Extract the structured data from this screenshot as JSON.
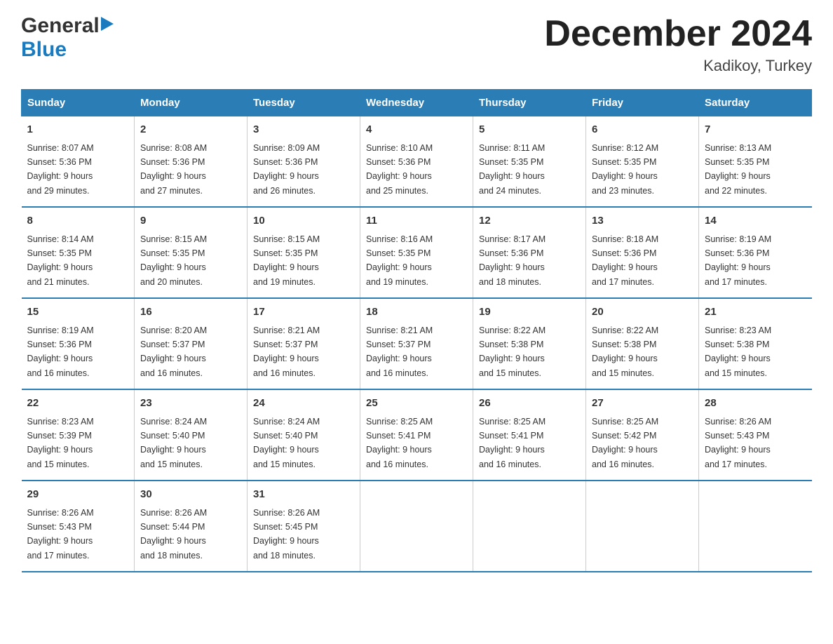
{
  "logo": {
    "general": "General",
    "blue": "Blue",
    "arrow_char": "▶"
  },
  "title": {
    "month_year": "December 2024",
    "location": "Kadikoy, Turkey"
  },
  "days_header": [
    "Sunday",
    "Monday",
    "Tuesday",
    "Wednesday",
    "Thursday",
    "Friday",
    "Saturday"
  ],
  "weeks": [
    [
      {
        "day": "1",
        "sunrise": "8:07 AM",
        "sunset": "5:36 PM",
        "daylight": "9 hours and 29 minutes."
      },
      {
        "day": "2",
        "sunrise": "8:08 AM",
        "sunset": "5:36 PM",
        "daylight": "9 hours and 27 minutes."
      },
      {
        "day": "3",
        "sunrise": "8:09 AM",
        "sunset": "5:36 PM",
        "daylight": "9 hours and 26 minutes."
      },
      {
        "day": "4",
        "sunrise": "8:10 AM",
        "sunset": "5:36 PM",
        "daylight": "9 hours and 25 minutes."
      },
      {
        "day": "5",
        "sunrise": "8:11 AM",
        "sunset": "5:35 PM",
        "daylight": "9 hours and 24 minutes."
      },
      {
        "day": "6",
        "sunrise": "8:12 AM",
        "sunset": "5:35 PM",
        "daylight": "9 hours and 23 minutes."
      },
      {
        "day": "7",
        "sunrise": "8:13 AM",
        "sunset": "5:35 PM",
        "daylight": "9 hours and 22 minutes."
      }
    ],
    [
      {
        "day": "8",
        "sunrise": "8:14 AM",
        "sunset": "5:35 PM",
        "daylight": "9 hours and 21 minutes."
      },
      {
        "day": "9",
        "sunrise": "8:15 AM",
        "sunset": "5:35 PM",
        "daylight": "9 hours and 20 minutes."
      },
      {
        "day": "10",
        "sunrise": "8:15 AM",
        "sunset": "5:35 PM",
        "daylight": "9 hours and 19 minutes."
      },
      {
        "day": "11",
        "sunrise": "8:16 AM",
        "sunset": "5:35 PM",
        "daylight": "9 hours and 19 minutes."
      },
      {
        "day": "12",
        "sunrise": "8:17 AM",
        "sunset": "5:36 PM",
        "daylight": "9 hours and 18 minutes."
      },
      {
        "day": "13",
        "sunrise": "8:18 AM",
        "sunset": "5:36 PM",
        "daylight": "9 hours and 17 minutes."
      },
      {
        "day": "14",
        "sunrise": "8:19 AM",
        "sunset": "5:36 PM",
        "daylight": "9 hours and 17 minutes."
      }
    ],
    [
      {
        "day": "15",
        "sunrise": "8:19 AM",
        "sunset": "5:36 PM",
        "daylight": "9 hours and 16 minutes."
      },
      {
        "day": "16",
        "sunrise": "8:20 AM",
        "sunset": "5:37 PM",
        "daylight": "9 hours and 16 minutes."
      },
      {
        "day": "17",
        "sunrise": "8:21 AM",
        "sunset": "5:37 PM",
        "daylight": "9 hours and 16 minutes."
      },
      {
        "day": "18",
        "sunrise": "8:21 AM",
        "sunset": "5:37 PM",
        "daylight": "9 hours and 16 minutes."
      },
      {
        "day": "19",
        "sunrise": "8:22 AM",
        "sunset": "5:38 PM",
        "daylight": "9 hours and 15 minutes."
      },
      {
        "day": "20",
        "sunrise": "8:22 AM",
        "sunset": "5:38 PM",
        "daylight": "9 hours and 15 minutes."
      },
      {
        "day": "21",
        "sunrise": "8:23 AM",
        "sunset": "5:38 PM",
        "daylight": "9 hours and 15 minutes."
      }
    ],
    [
      {
        "day": "22",
        "sunrise": "8:23 AM",
        "sunset": "5:39 PM",
        "daylight": "9 hours and 15 minutes."
      },
      {
        "day": "23",
        "sunrise": "8:24 AM",
        "sunset": "5:40 PM",
        "daylight": "9 hours and 15 minutes."
      },
      {
        "day": "24",
        "sunrise": "8:24 AM",
        "sunset": "5:40 PM",
        "daylight": "9 hours and 15 minutes."
      },
      {
        "day": "25",
        "sunrise": "8:25 AM",
        "sunset": "5:41 PM",
        "daylight": "9 hours and 16 minutes."
      },
      {
        "day": "26",
        "sunrise": "8:25 AM",
        "sunset": "5:41 PM",
        "daylight": "9 hours and 16 minutes."
      },
      {
        "day": "27",
        "sunrise": "8:25 AM",
        "sunset": "5:42 PM",
        "daylight": "9 hours and 16 minutes."
      },
      {
        "day": "28",
        "sunrise": "8:26 AM",
        "sunset": "5:43 PM",
        "daylight": "9 hours and 17 minutes."
      }
    ],
    [
      {
        "day": "29",
        "sunrise": "8:26 AM",
        "sunset": "5:43 PM",
        "daylight": "9 hours and 17 minutes."
      },
      {
        "day": "30",
        "sunrise": "8:26 AM",
        "sunset": "5:44 PM",
        "daylight": "9 hours and 18 minutes."
      },
      {
        "day": "31",
        "sunrise": "8:26 AM",
        "sunset": "5:45 PM",
        "daylight": "9 hours and 18 minutes."
      },
      null,
      null,
      null,
      null
    ]
  ],
  "labels": {
    "sunrise": "Sunrise:",
    "sunset": "Sunset:",
    "daylight": "Daylight:"
  }
}
